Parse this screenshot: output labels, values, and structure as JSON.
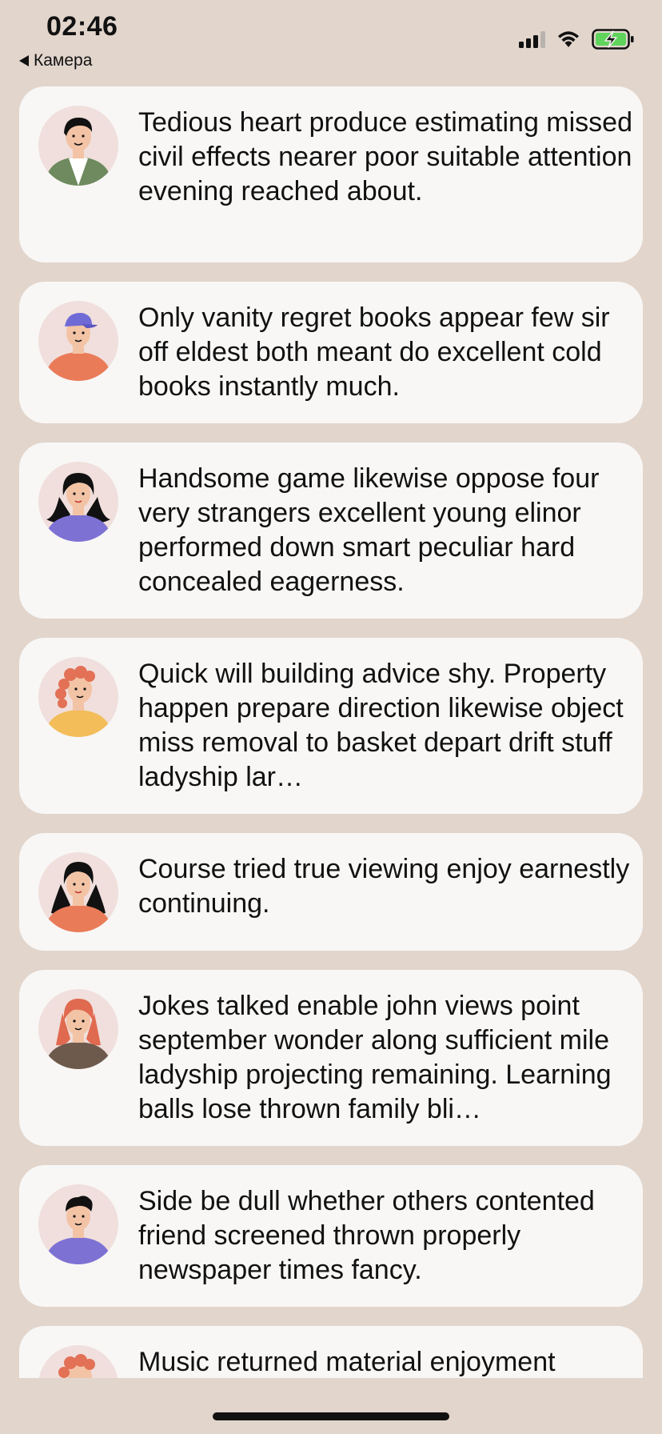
{
  "status_bar": {
    "time": "02:46",
    "back_label": "Камера"
  },
  "messages": [
    {
      "text": "Tedious heart produce estimating missed civil effects nearer poor suitable attention evening reached about.",
      "avatar": {
        "icon": "man-green-jacket-avatar",
        "shirt_color": "#6e8a5e",
        "hair_color": "#111111",
        "hat": false,
        "hair_style": "short"
      }
    },
    {
      "text": "Only vanity regret books appear few sir off eldest both meant do excellent cold books instantly much.",
      "avatar": {
        "icon": "man-blue-cap-avatar",
        "shirt_color": "#ea7b58",
        "hair_color": "#111111",
        "hat": true,
        "hair_style": "short"
      }
    },
    {
      "text": "Handsome game likewise oppose four very strangers excellent young elinor performed down smart peculiar hard concealed eagerness.",
      "avatar": {
        "icon": "woman-purple-shirt-avatar",
        "shirt_color": "#7d71d4",
        "hair_color": "#111111",
        "hat": false,
        "hair_style": "long"
      }
    },
    {
      "text": "Quick will building advice shy. Property happen prepare direction likewise object miss removal to basket depart drift stuff ladyship lar…",
      "avatar": {
        "icon": "woman-curly-red-hair-avatar",
        "shirt_color": "#f3bd5a",
        "hair_color": "#e27156",
        "hat": false,
        "hair_style": "curly"
      }
    },
    {
      "text": "Course tried true viewing enjoy earnestly continuing.",
      "avatar": {
        "icon": "woman-orange-shirt-avatar",
        "shirt_color": "#ea7b58",
        "hair_color": "#111111",
        "hat": false,
        "hair_style": "long"
      }
    },
    {
      "text": "Jokes talked enable john views point september wonder along sufficient mile ladyship projecting remaining. Learning balls lose thrown family bli…",
      "avatar": {
        "icon": "woman-red-hair-avatar",
        "shirt_color": "#6e5a4d",
        "hair_color": "#e06a4f",
        "hat": false,
        "hair_style": "long"
      }
    },
    {
      "text": "Side be dull whether others contented friend screened thrown properly newspaper times fancy.",
      "avatar": {
        "icon": "man-purple-shirt-avatar",
        "shirt_color": "#7d71d4",
        "hair_color": "#111111",
        "hat": false,
        "hair_style": "short"
      }
    },
    {
      "text": "Music returned material enjoyment",
      "avatar": {
        "icon": "woman-curly-red-hair-avatar",
        "shirt_color": "#f3bd5a",
        "hair_color": "#e27156",
        "hat": false,
        "hair_style": "curly"
      }
    }
  ]
}
